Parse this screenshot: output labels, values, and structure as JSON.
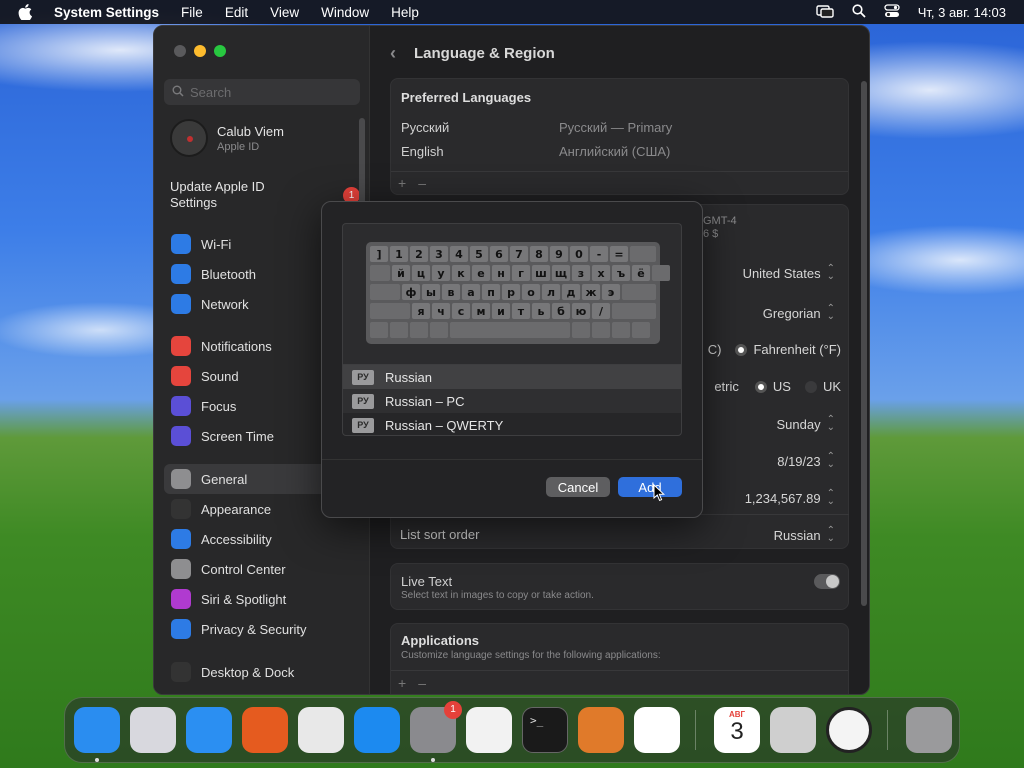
{
  "menubar": {
    "app": "System Settings",
    "items": [
      "File",
      "Edit",
      "View",
      "Window",
      "Help"
    ],
    "clock": "Чт, 3 авг.  14:03"
  },
  "sidebar": {
    "search_placeholder": "Search",
    "account": {
      "name": "Calub Viem",
      "sub": "Apple ID"
    },
    "update": {
      "label": "Update Apple ID Settings",
      "badge": "1"
    },
    "group1": [
      {
        "label": "Wi-Fi",
        "icon": "wifi-icon",
        "color": "#2d7be5"
      },
      {
        "label": "Bluetooth",
        "icon": "bluetooth-icon",
        "color": "#2d7be5"
      },
      {
        "label": "Network",
        "icon": "globe-icon",
        "color": "#2d7be5"
      }
    ],
    "group2": [
      {
        "label": "Notifications",
        "icon": "bell-icon",
        "color": "#e5453d"
      },
      {
        "label": "Sound",
        "icon": "speaker-icon",
        "color": "#e5453d"
      },
      {
        "label": "Focus",
        "icon": "moon-icon",
        "color": "#5b4fd6"
      },
      {
        "label": "Screen Time",
        "icon": "hourglass-icon",
        "color": "#5b4fd6"
      }
    ],
    "group3": [
      {
        "label": "General",
        "icon": "gear-icon",
        "color": "#8e8e90"
      },
      {
        "label": "Appearance",
        "icon": "appearance-icon",
        "color": "#333"
      },
      {
        "label": "Accessibility",
        "icon": "accessibility-icon",
        "color": "#2d7be5"
      },
      {
        "label": "Control Center",
        "icon": "control-center-icon",
        "color": "#8e8e90"
      },
      {
        "label": "Siri & Spotlight",
        "icon": "siri-icon",
        "color": "#b03ad0"
      },
      {
        "label": "Privacy & Security",
        "icon": "hand-icon",
        "color": "#2d7be5"
      }
    ],
    "group4": [
      {
        "label": "Desktop & Dock",
        "icon": "dock-icon",
        "color": "#333"
      }
    ]
  },
  "content": {
    "title": "Language & Region",
    "preferred_languages": {
      "title": "Preferred Languages",
      "rows": [
        {
          "name": "Русский",
          "value": "Русский — Primary"
        },
        {
          "name": "English",
          "value": "Английский (США)"
        }
      ],
      "add": "+",
      "remove": "–"
    },
    "region_partial": {
      "line1": "GMT-4",
      "line2": "6 $"
    },
    "values": {
      "region": "United States",
      "calendar": "Gregorian",
      "temperature_c": "C)",
      "temperature_f": "Fahrenheit (°F)",
      "measurement_prefix": "etric",
      "measurement_us": "US",
      "measurement_uk": "UK",
      "first_day": "Sunday",
      "date_format": "8/19/23",
      "number_format": "1,234,567.89"
    },
    "sort_order": {
      "label": "List sort order",
      "value": "Russian"
    },
    "live_text": {
      "title": "Live Text",
      "sub": "Select text in images to copy or take action."
    },
    "applications": {
      "title": "Applications",
      "sub": "Customize language settings for the following applications:",
      "add": "+",
      "remove": "–"
    }
  },
  "dialog": {
    "keyboard_rows": [
      [
        "]",
        "1",
        "2",
        "3",
        "4",
        "5",
        "6",
        "7",
        "8",
        "9",
        "0",
        "-",
        "="
      ],
      [
        "й",
        "ц",
        "у",
        "к",
        "е",
        "н",
        "г",
        "ш",
        "щ",
        "з",
        "х",
        "ъ",
        "ё"
      ],
      [
        "ф",
        "ы",
        "в",
        "а",
        "п",
        "р",
        "о",
        "л",
        "д",
        "ж",
        "э"
      ],
      [
        "я",
        "ч",
        "с",
        "м",
        "и",
        "т",
        "ь",
        "б",
        "ю",
        "/"
      ]
    ],
    "layouts": [
      {
        "badge": "РУ",
        "label": "Russian"
      },
      {
        "badge": "РУ",
        "label": "Russian – PC"
      },
      {
        "badge": "РУ",
        "label": "Russian – QWERTY"
      }
    ],
    "cancel": "Cancel",
    "add": "Add"
  },
  "dock": {
    "apps": [
      {
        "name": "finder-icon",
        "color": "#2a8df0"
      },
      {
        "name": "launchpad-icon",
        "color": "#d8d8de"
      },
      {
        "name": "safari-icon",
        "color": "#2b8ff2"
      },
      {
        "name": "firefox-icon",
        "color": "#e55b1f"
      },
      {
        "name": "chrome-icon",
        "color": "#e8e8e8"
      },
      {
        "name": "app-store-icon",
        "color": "#1c8af0"
      },
      {
        "name": "system-settings-icon",
        "color": "#8a8a8e",
        "badge": "1"
      },
      {
        "name": "textedit-icon",
        "color": "#f2f2f2"
      },
      {
        "name": "terminal-icon",
        "color": "#1a1a1a"
      },
      {
        "name": "garageband-icon",
        "color": "#e07a2a"
      },
      {
        "name": "vscode-icon",
        "color": "#ffffff"
      },
      {
        "name": "calendar-icon",
        "color": "#ffffff",
        "month": "АВГ",
        "day": "3"
      },
      {
        "name": "calculator-icon",
        "color": "#cfcfcf"
      },
      {
        "name": "clock-icon",
        "color": "#f4f4f4"
      },
      {
        "name": "trash-icon",
        "color": "#9a9a9c"
      }
    ]
  }
}
